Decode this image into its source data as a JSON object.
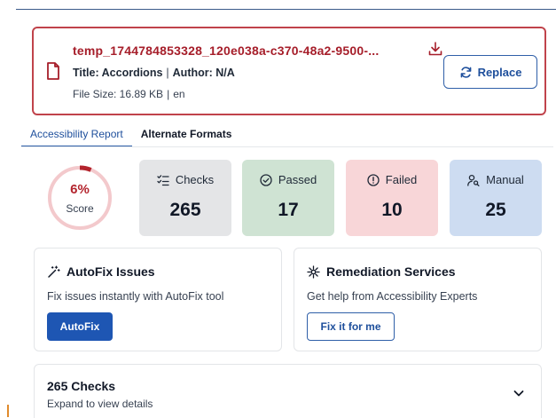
{
  "file": {
    "name": "temp_1744784853328_120e038a-c370-48a2-9500-...",
    "title_label": "Title: Accordions",
    "author_label": "Author: N/A",
    "meta_separator": "|",
    "size_label": "File Size: 16.89 KB",
    "language": "en",
    "replace_label": "Replace"
  },
  "tabs": [
    {
      "label": "Accessibility Report",
      "active": true
    },
    {
      "label": "Alternate Formats",
      "active": false
    }
  ],
  "score": {
    "value": "6%",
    "label": "Score",
    "fraction": 0.06
  },
  "stats": {
    "checks": {
      "label": "Checks",
      "value": "265"
    },
    "passed": {
      "label": "Passed",
      "value": "17"
    },
    "failed": {
      "label": "Failed",
      "value": "10"
    },
    "manual": {
      "label": "Manual",
      "value": "25"
    }
  },
  "autofix": {
    "title": "AutoFix Issues",
    "description": "Fix issues instantly with AutoFix tool",
    "button": "AutoFix"
  },
  "remediation": {
    "title": "Remediation Services",
    "description": "Get help from Accessibility Experts",
    "button": "Fix it for me"
  },
  "checks_panel": {
    "title": "265 Checks",
    "subtitle": "Expand to view details"
  },
  "colors": {
    "accent": "#2f5fa8",
    "error": "#c0434b",
    "passed_bg": "#cfe3d3",
    "failed_bg": "#f8d6d8",
    "manual_bg": "#cddcf1",
    "checks_bg": "#e4e5e7"
  }
}
